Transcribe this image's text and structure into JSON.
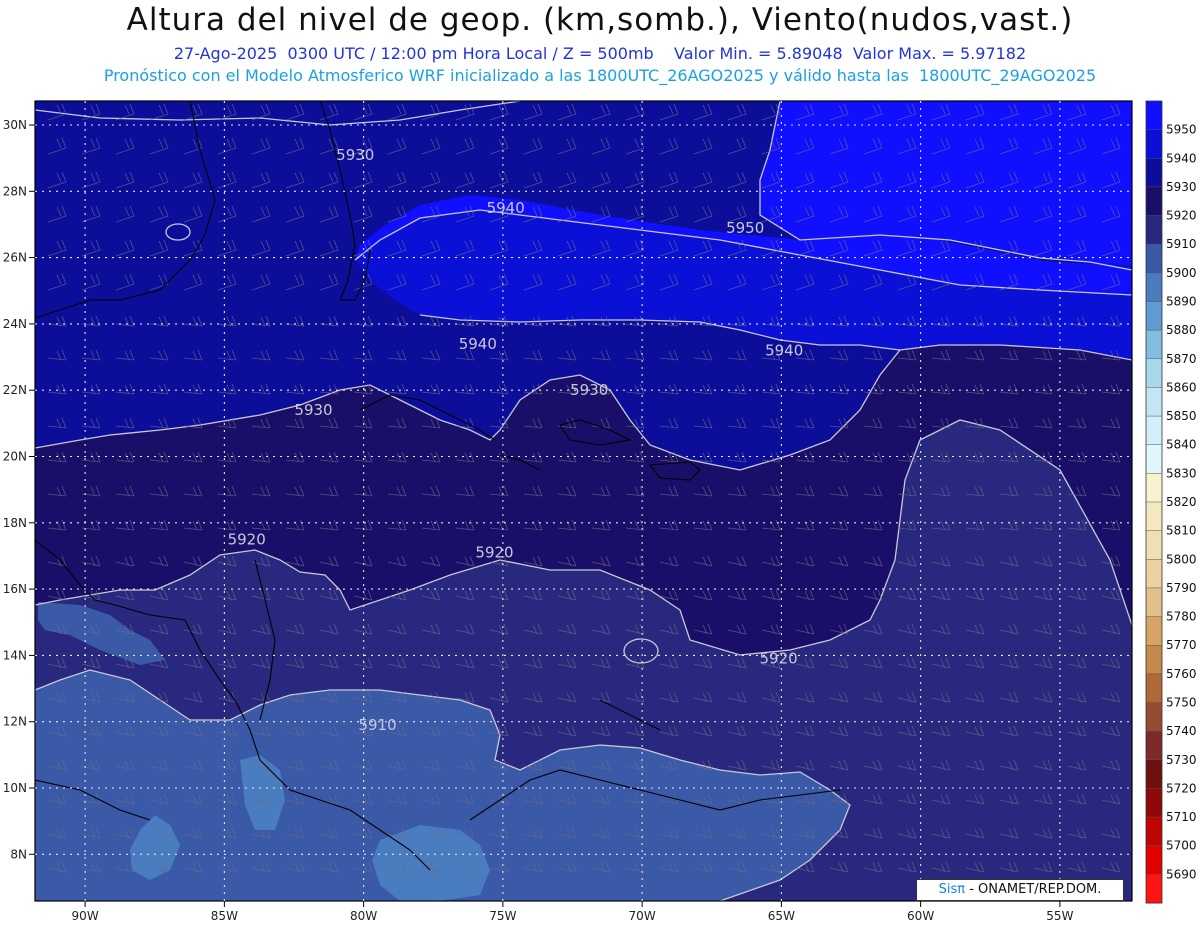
{
  "header": {
    "title": "Altura del nivel de geop. (km,somb.), Viento(nudos,vast.)",
    "line1": "27-Ago-2025  0300 UTC / 12:00 pm Hora Local / Z = 500mb    Valor Min. = 5.89048  Valor Max. = 5.97182",
    "line2": "Pronóstico con el Modelo Atmosferico WRF inicializado a las 1800UTC_26AGO2025 y válido hasta las  1800UTC_29AGO2025"
  },
  "axes": {
    "lon_labels": [
      "90W",
      "85W",
      "80W",
      "75W",
      "70W",
      "65W",
      "60W",
      "55W"
    ],
    "lat_labels": [
      "30N",
      "28N",
      "26N",
      "24N",
      "22N",
      "20N",
      "18N",
      "16N",
      "14N",
      "12N",
      "10N",
      "8N"
    ]
  },
  "contour_labels": [
    {
      "text": "5930",
      "lon": -80.3,
      "lat": 29.1
    },
    {
      "text": "5940",
      "lon": -74.9,
      "lat": 27.5
    },
    {
      "text": "5950",
      "lon": -66.3,
      "lat": 26.9
    },
    {
      "text": "5940",
      "lon": -75.9,
      "lat": 23.4
    },
    {
      "text": "5940",
      "lon": -64.9,
      "lat": 23.2
    },
    {
      "text": "5930",
      "lon": -71.9,
      "lat": 22.0
    },
    {
      "text": "5930",
      "lon": -81.8,
      "lat": 21.4
    },
    {
      "text": "5920",
      "lon": -84.2,
      "lat": 17.5
    },
    {
      "text": "5920",
      "lon": -75.3,
      "lat": 17.1
    },
    {
      "text": "5920",
      "lon": -65.1,
      "lat": 13.9
    },
    {
      "text": "5910",
      "lon": -79.5,
      "lat": 11.9
    }
  ],
  "colorbar": {
    "levels": [
      5950,
      5940,
      5930,
      5920,
      5910,
      5900,
      5890,
      5880,
      5870,
      5860,
      5850,
      5840,
      5830,
      5820,
      5810,
      5800,
      5790,
      5780,
      5770,
      5760,
      5750,
      5740,
      5730,
      5720,
      5710,
      5700,
      5690
    ],
    "colors": [
      "#1010ff",
      "#0a10d6",
      "#0c0e9a",
      "#1a0f68",
      "#28287e",
      "#3a5aa8",
      "#4a7cc0",
      "#5f9ad2",
      "#82bde0",
      "#a8d8ec",
      "#c4e6f4",
      "#d2eef8",
      "#dff6fb",
      "#f8f2d0",
      "#f4e8c0",
      "#efdfb2",
      "#ebd2a0",
      "#e3c08a",
      "#d6a466",
      "#c48a4c",
      "#b06a3a",
      "#964c32",
      "#7e2a2a",
      "#6e1010",
      "#920808",
      "#c00404",
      "#e20000",
      "#ff1414"
    ]
  },
  "credit": {
    "sis": "Sisπ",
    "rest": " - ONAMET/REP.DOM."
  }
}
